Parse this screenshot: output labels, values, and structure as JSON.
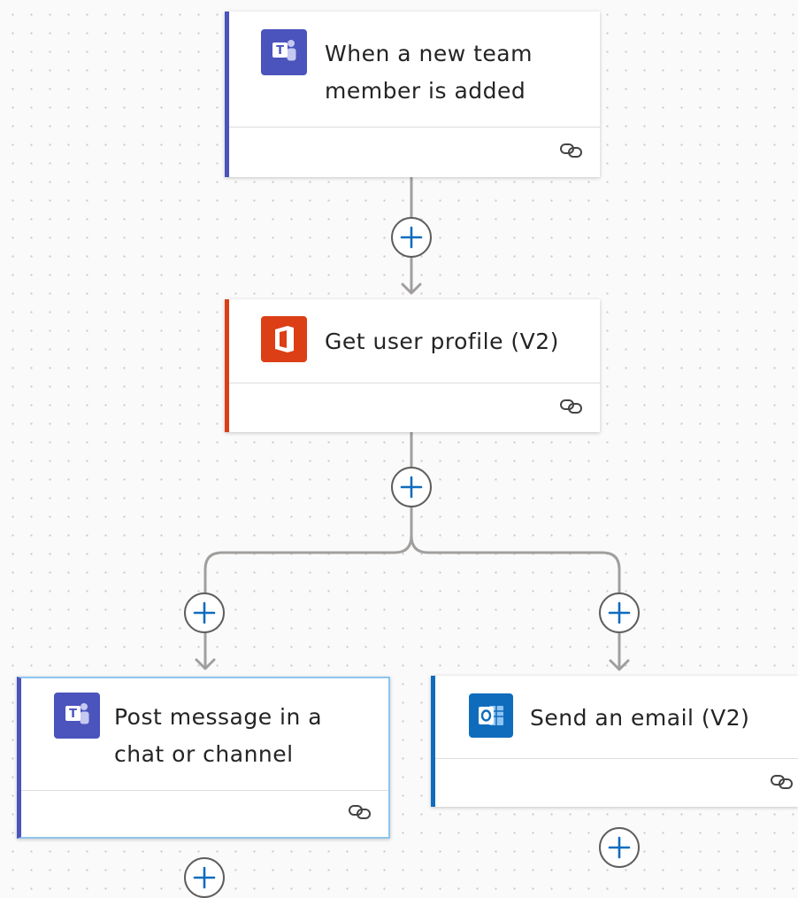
{
  "colors": {
    "teams": "#4b53bc",
    "office": "#dc3e15",
    "outlook": "#0f6cbd",
    "connector": "#a19f9d",
    "plus": "#0f6cbd"
  },
  "steps": {
    "trigger": {
      "title": "When a new team member is added",
      "icon": "teams-icon"
    },
    "get_profile": {
      "title": "Get user profile (V2)",
      "icon": "office-icon"
    },
    "post_message": {
      "title": "Post message in a chat or channel",
      "icon": "teams-icon"
    },
    "send_email": {
      "title": "Send an email (V2)",
      "icon": "outlook-icon"
    }
  },
  "footer_icon": "link-icon",
  "insert_button_icon": "plus-icon"
}
